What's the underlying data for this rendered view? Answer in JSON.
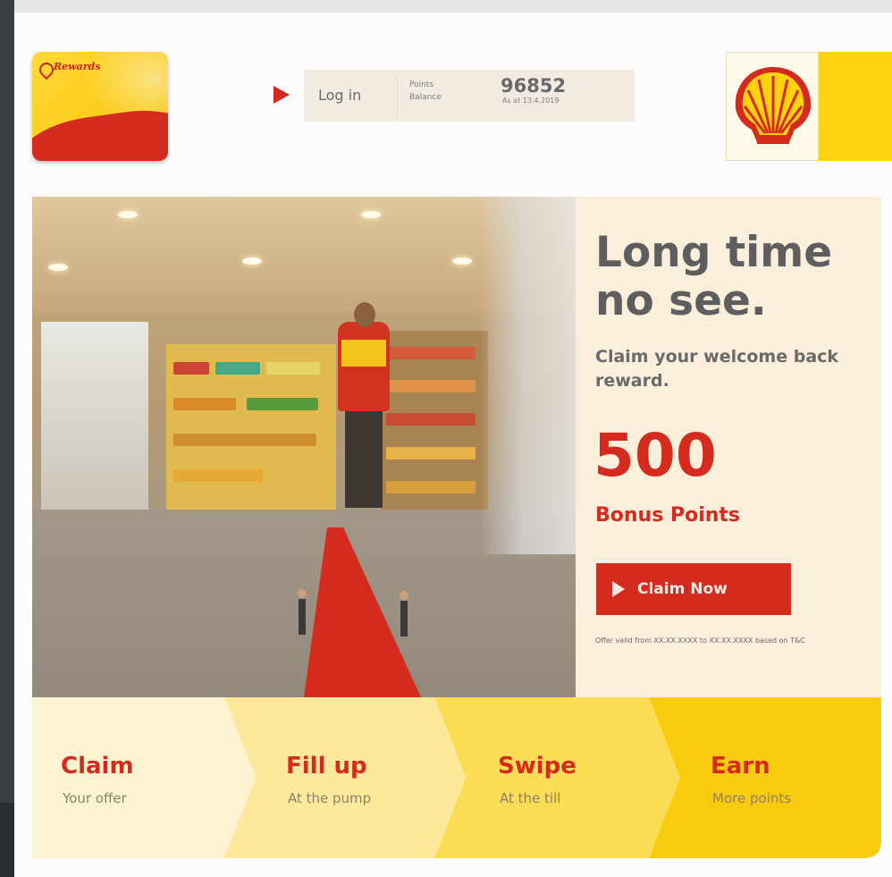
{
  "card": {
    "brand": "Rewards",
    "fine_print": ""
  },
  "login": {
    "button_label": "Log in",
    "points_label": "Points Balance",
    "points_value": "96852",
    "points_date": "As at 13.4.2019"
  },
  "hero": {
    "headline": "Long time no see.",
    "subhead": "Claim your welcome back reward.",
    "points": "500",
    "points_label": "Bonus Points",
    "cta_label": "Claim Now",
    "offer_note": "Offer valid from XX.XX.XXXX to XX.XX.XXXX based on T&C"
  },
  "steps": [
    {
      "title": "Claim",
      "sub": "Your offer"
    },
    {
      "title": "Fill up",
      "sub": "At the pump"
    },
    {
      "title": "Swipe",
      "sub": "At the till"
    },
    {
      "title": "Earn",
      "sub": "More points"
    }
  ],
  "colors": {
    "shell_red": "#d52b1e",
    "shell_yellow": "#fdd20f",
    "text_grey": "#5e5e60"
  },
  "icons": [
    "play-arrow-icon",
    "shell-pecten-logo"
  ]
}
